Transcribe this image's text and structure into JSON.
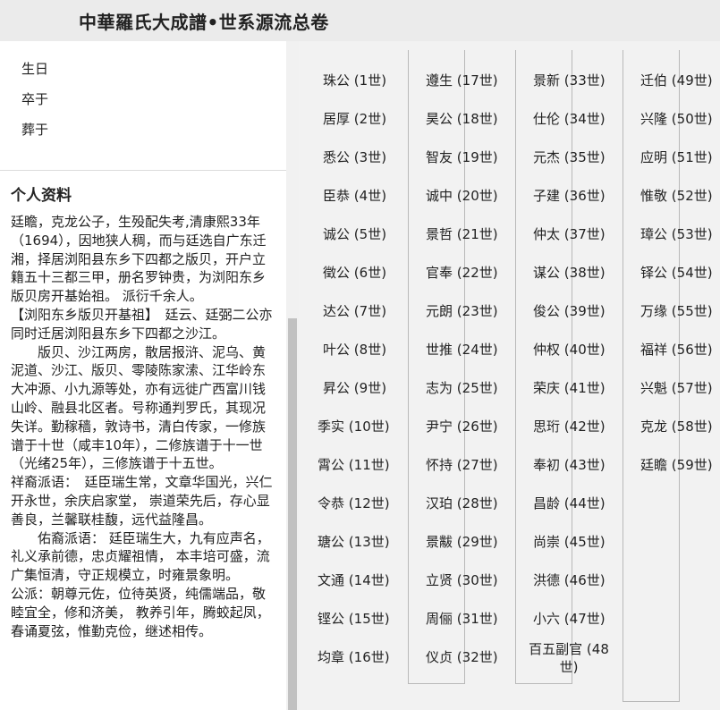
{
  "header": {
    "title": "中華羅氏大成譜•世系源流总卷"
  },
  "left_panel": {
    "info_fields": [
      {
        "label": "生日"
      },
      {
        "label": "卒于"
      },
      {
        "label": "葬于"
      }
    ],
    "profile": {
      "title": "个人资料",
      "bio": "廷瞻，克龙公子，生殁配失考,清康熙33年（1694），因地狭人稠，而与廷选自广东迁湘，择居浏阳县东乡下四都之版贝，开户立籍五十三都三甲，册名罗钟贵，为浏阳东乡版贝房开基始祖。 派衍千余人。\n【浏阳东乡版贝开基祖】　廷云、廷弼二公亦同时迁居浏阳县东乡下四都之沙江。\n　　版贝、沙江两房，散居报浒、泥乌、黄泥道、沙江、版贝、零陵陈家溹、江华岭东大冲源、小九源等处，亦有远徙广西富川钱山岭、融县北区者。号称通判罗氏，其现况失详。勤稼穑，敦诗书，清白传家，一修族谱于十世（咸丰10年），二修族谱于十一世（光绪25年），三修族谱于十五世。\n祥裔派语：　廷臣瑞生常，文章华国光，兴仁开永世，余庆启家堂， 崇道荣先后，存心显善良，兰馨联桂馥，远代益隆昌。\n　　佑裔派语： 廷臣瑞生大，九有应声名，礼义承前德，忠贞耀祖情， 本丰培可盛，流广集恒清，守正规模立，时雍景象明。　　　公派：朝尊元佐，位待英贤，纯儒端品，敬睦宜全，修和济美， 教养引年，腾蛟起凤，春诵夏弦，惟勤克俭，继述相传。"
    }
  },
  "lineage": {
    "columns": [
      [
        {
          "name": "珠公",
          "gen": "(1世)"
        },
        {
          "name": "居厚",
          "gen": "(2世)"
        },
        {
          "name": "悉公",
          "gen": "(3世)"
        },
        {
          "name": "臣恭",
          "gen": "(4世)"
        },
        {
          "name": "诚公",
          "gen": "(5世)"
        },
        {
          "name": "徵公",
          "gen": "(6世)"
        },
        {
          "name": "达公",
          "gen": "(7世)"
        },
        {
          "name": "叶公",
          "gen": "(8世)"
        },
        {
          "name": "昇公",
          "gen": "(9世)"
        },
        {
          "name": "季实",
          "gen": "(10世)"
        },
        {
          "name": "霄公",
          "gen": "(11世)"
        },
        {
          "name": "令恭",
          "gen": "(12世)"
        },
        {
          "name": "瑭公",
          "gen": "(13世)"
        },
        {
          "name": "文通",
          "gen": "(14世)"
        },
        {
          "name": "铿公",
          "gen": "(15世)"
        },
        {
          "name": "均章",
          "gen": "(16世)"
        }
      ],
      [
        {
          "name": "遵生",
          "gen": "(17世)"
        },
        {
          "name": "昊公",
          "gen": "(18世)"
        },
        {
          "name": "智友",
          "gen": "(19世)"
        },
        {
          "name": "诚中",
          "gen": "(20世)"
        },
        {
          "name": "景哲",
          "gen": "(21世)"
        },
        {
          "name": "官奉",
          "gen": "(22世)"
        },
        {
          "name": "元朗",
          "gen": "(23世)"
        },
        {
          "name": "世推",
          "gen": "(24世)"
        },
        {
          "name": "志为",
          "gen": "(25世)"
        },
        {
          "name": "尹宁",
          "gen": "(26世)"
        },
        {
          "name": "怀持",
          "gen": "(27世)"
        },
        {
          "name": "汉珀",
          "gen": "(28世)"
        },
        {
          "name": "景黻",
          "gen": "(29世)"
        },
        {
          "name": "立贤",
          "gen": "(30世)"
        },
        {
          "name": "周俪",
          "gen": "(31世)"
        },
        {
          "name": "仪贞",
          "gen": "(32世)"
        }
      ],
      [
        {
          "name": "景新",
          "gen": "(33世)"
        },
        {
          "name": "仕伦",
          "gen": "(34世)"
        },
        {
          "name": "元杰",
          "gen": "(35世)"
        },
        {
          "name": "子建",
          "gen": "(36世)"
        },
        {
          "name": "仲太",
          "gen": "(37世)"
        },
        {
          "name": "谋公",
          "gen": "(38世)"
        },
        {
          "name": "俊公",
          "gen": "(39世)"
        },
        {
          "name": "仲权",
          "gen": "(40世)"
        },
        {
          "name": "荣庆",
          "gen": "(41世)"
        },
        {
          "name": "思珩",
          "gen": "(42世)"
        },
        {
          "name": "奉初",
          "gen": "(43世)"
        },
        {
          "name": "昌龄",
          "gen": "(44世)"
        },
        {
          "name": "尚崇",
          "gen": "(45世)"
        },
        {
          "name": "洪德",
          "gen": "(46世)"
        },
        {
          "name": "小六",
          "gen": "(47世)"
        },
        {
          "name": "百五副官",
          "gen": "(48世)"
        }
      ],
      [
        {
          "name": "迁伯",
          "gen": "(49世)"
        },
        {
          "name": "兴隆",
          "gen": "(50世)"
        },
        {
          "name": "应明",
          "gen": "(51世)"
        },
        {
          "name": "惟敬",
          "gen": "(52世)"
        },
        {
          "name": "璋公",
          "gen": "(53世)"
        },
        {
          "name": "铎公",
          "gen": "(54世)"
        },
        {
          "name": "万缘",
          "gen": "(55世)"
        },
        {
          "name": "福祥",
          "gen": "(56世)"
        },
        {
          "name": "兴魁",
          "gen": "(57世)"
        },
        {
          "name": "克龙",
          "gen": "(58世)"
        },
        {
          "name": "廷瞻",
          "gen": "(59世)"
        }
      ]
    ]
  }
}
